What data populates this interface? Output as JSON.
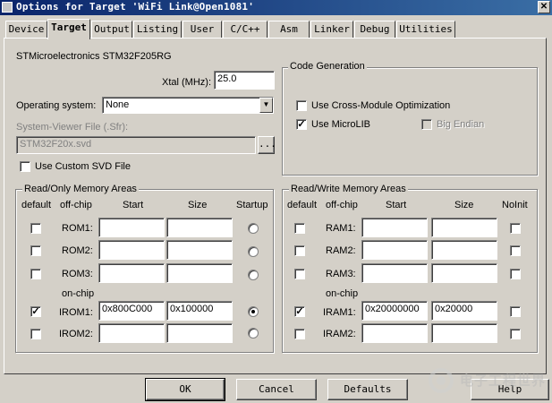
{
  "window": {
    "title": "Options for Target 'WiFi Link@Open1081'",
    "close_glyph": "✕"
  },
  "tabs": [
    "Device",
    "Target",
    "Output",
    "Listing",
    "User",
    "C/C++",
    "Asm",
    "Linker",
    "Debug",
    "Utilities"
  ],
  "active_tab": "Target",
  "target": {
    "device_name": "STMicroelectronics STM32F205RG",
    "xtal_label": "Xtal (MHz):",
    "xtal_value": "25.0",
    "os_label": "Operating system:",
    "os_value": "None",
    "svd_label": "System-Viewer File (.Sfr):",
    "svd_value": "STM32F20x.svd",
    "browse_label": "...",
    "custom_svd_label": "Use Custom SVD File"
  },
  "code_generation": {
    "title": "Code Generation",
    "cross_module_label": "Use Cross-Module Optimization",
    "microlib_label": "Use MicroLIB",
    "big_endian_label": "Big Endian"
  },
  "ro_memory": {
    "title": "Read/Only Memory Areas",
    "headers": {
      "default": "default",
      "offchip": "off-chip",
      "start": "Start",
      "size": "Size",
      "startup": "Startup"
    },
    "onchip_label": "on-chip",
    "rows": [
      {
        "name": "ROM1:",
        "start": "",
        "size": "",
        "default": false,
        "startup": false
      },
      {
        "name": "ROM2:",
        "start": "",
        "size": "",
        "default": false,
        "startup": false
      },
      {
        "name": "ROM3:",
        "start": "",
        "size": "",
        "default": false,
        "startup": false
      },
      {
        "name": "IROM1:",
        "start": "0x800C000",
        "size": "0x100000",
        "default": true,
        "startup": true
      },
      {
        "name": "IROM2:",
        "start": "",
        "size": "",
        "default": false,
        "startup": false
      }
    ]
  },
  "rw_memory": {
    "title": "Read/Write Memory Areas",
    "headers": {
      "default": "default",
      "offchip": "off-chip",
      "start": "Start",
      "size": "Size",
      "noinit": "NoInit"
    },
    "onchip_label": "on-chip",
    "rows": [
      {
        "name": "RAM1:",
        "start": "",
        "size": "",
        "default": false,
        "noinit": false
      },
      {
        "name": "RAM2:",
        "start": "",
        "size": "",
        "default": false,
        "noinit": false
      },
      {
        "name": "RAM3:",
        "start": "",
        "size": "",
        "default": false,
        "noinit": false
      },
      {
        "name": "IRAM1:",
        "start": "0x20000000",
        "size": "0x20000",
        "default": true,
        "noinit": false
      },
      {
        "name": "IRAM2:",
        "start": "",
        "size": "",
        "default": false,
        "noinit": false
      }
    ]
  },
  "buttons": {
    "ok": "OK",
    "cancel": "Cancel",
    "defaults": "Defaults",
    "help": "Help"
  },
  "watermark_text": "电子工程世界",
  "checkmark": "✓",
  "dropdown_glyph": "▼"
}
